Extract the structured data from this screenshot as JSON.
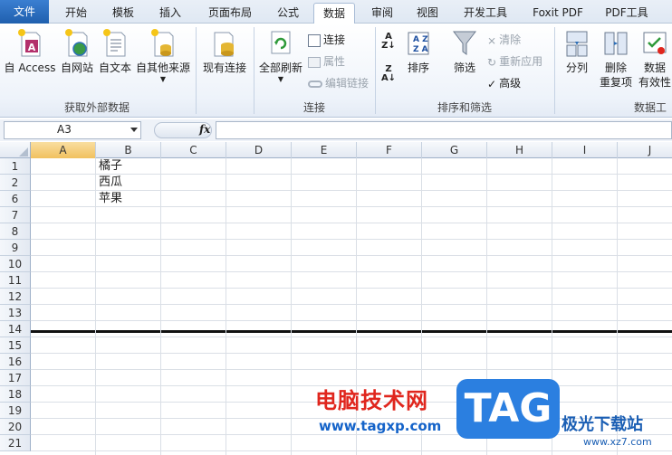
{
  "tabs": [
    "文件",
    "开始",
    "模板",
    "插入",
    "页面布局",
    "公式",
    "数据",
    "审阅",
    "视图",
    "开发工具",
    "Foxit PDF",
    "PDF工具"
  ],
  "active_tab": "数据",
  "ribbon": {
    "get_external": {
      "label": "获取外部数据",
      "buttons": [
        "自 Access",
        "自网站",
        "自文本",
        "自其他来源"
      ]
    },
    "existing_conn": "现有连接",
    "connections": {
      "label": "连接",
      "refresh_all": "全部刷新",
      "conn": "连接",
      "props": "属性",
      "edit_links": "编辑链接"
    },
    "sort_filter": {
      "label": "排序和筛选",
      "sort": "排序",
      "filter": "筛选",
      "clear": "清除",
      "reapply": "重新应用",
      "advanced": "高级"
    },
    "data_tools": {
      "label": "数据工",
      "split": "分列",
      "remove_dup_1": "删除",
      "remove_dup_2": "重复项",
      "validation_1": "数据",
      "validation_2": "有效性"
    }
  },
  "formula_bar": {
    "name_box": "A3",
    "fx": "fx",
    "content": ""
  },
  "sheet": {
    "columns": [
      "A",
      "B",
      "C",
      "D",
      "E",
      "F",
      "G",
      "H",
      "I",
      "J"
    ],
    "rows": [
      "1",
      "2",
      "6",
      "7",
      "8",
      "9",
      "10",
      "11",
      "12",
      "13",
      "14",
      "15",
      "16",
      "17",
      "18",
      "19",
      "20",
      "21"
    ],
    "cells": {
      "B1": "橘子",
      "B2": "西瓜",
      "B6": "苹果"
    }
  },
  "watermark": {
    "title": "电脑技术网",
    "url": "www.tagxp.com",
    "tag": "TAG",
    "site": "极光下载站",
    "site_url": "www.xz7.com"
  },
  "colors": {
    "accent": "#2b7fe0",
    "file_tab": "#2a6fc4",
    "selection": "#f1c15f"
  }
}
